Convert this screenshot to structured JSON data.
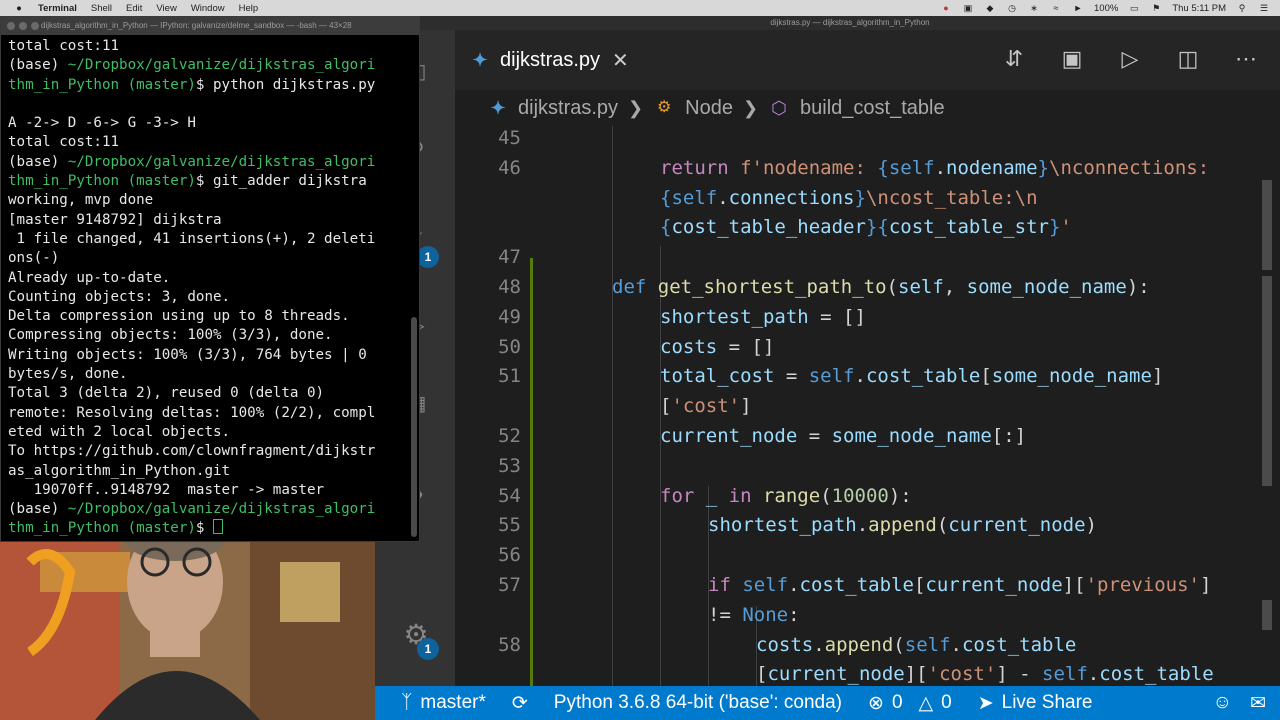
{
  "menubar": {
    "app": "Terminal",
    "items": [
      "Shell",
      "Edit",
      "View",
      "Window",
      "Help"
    ],
    "battery": "100%",
    "clock": "Thu 5:11 PM"
  },
  "terminal": {
    "title": "dijkstras_algorithm_in_Python — IPython: galvanize/delme_sandbox — -bash — 43×28",
    "lines": [
      {
        "parts": [
          {
            "t": "total cost:11",
            "c": ""
          }
        ]
      },
      {
        "parts": [
          {
            "t": "(base) ",
            "c": ""
          },
          {
            "t": "~/Dropbox/galvanize/dijkstras_algori",
            "c": "g"
          }
        ]
      },
      {
        "parts": [
          {
            "t": "thm_in_Python (master)",
            "c": "g"
          },
          {
            "t": "$ python dijkstras.py",
            "c": ""
          }
        ]
      },
      {
        "parts": [
          {
            "t": "",
            "c": ""
          }
        ]
      },
      {
        "parts": [
          {
            "t": "A -2-> D -6-> G -3-> H",
            "c": ""
          }
        ]
      },
      {
        "parts": [
          {
            "t": "total cost:11",
            "c": ""
          }
        ]
      },
      {
        "parts": [
          {
            "t": "(base) ",
            "c": ""
          },
          {
            "t": "~/Dropbox/galvanize/dijkstras_algori",
            "c": "g"
          }
        ]
      },
      {
        "parts": [
          {
            "t": "thm_in_Python (master)",
            "c": "g"
          },
          {
            "t": "$ git_adder dijkstra",
            "c": ""
          }
        ]
      },
      {
        "parts": [
          {
            "t": "working, mvp done",
            "c": ""
          }
        ]
      },
      {
        "parts": [
          {
            "t": "[master 9148792] dijkstra",
            "c": ""
          }
        ]
      },
      {
        "parts": [
          {
            "t": " 1 file changed, 41 insertions(+), 2 deleti",
            "c": ""
          }
        ]
      },
      {
        "parts": [
          {
            "t": "ons(-)",
            "c": ""
          }
        ]
      },
      {
        "parts": [
          {
            "t": "Already up-to-date.",
            "c": ""
          }
        ]
      },
      {
        "parts": [
          {
            "t": "Counting objects: 3, done.",
            "c": ""
          }
        ]
      },
      {
        "parts": [
          {
            "t": "Delta compression using up to 8 threads.",
            "c": ""
          }
        ]
      },
      {
        "parts": [
          {
            "t": "Compressing objects: 100% (3/3), done.",
            "c": ""
          }
        ]
      },
      {
        "parts": [
          {
            "t": "Writing objects: 100% (3/3), 764 bytes | 0",
            "c": ""
          }
        ]
      },
      {
        "parts": [
          {
            "t": "bytes/s, done.",
            "c": ""
          }
        ]
      },
      {
        "parts": [
          {
            "t": "Total 3 (delta 2), reused 0 (delta 0)",
            "c": ""
          }
        ]
      },
      {
        "parts": [
          {
            "t": "remote: Resolving deltas: 100% (2/2), compl",
            "c": ""
          }
        ]
      },
      {
        "parts": [
          {
            "t": "eted with 2 local objects.",
            "c": ""
          }
        ]
      },
      {
        "parts": [
          {
            "t": "To https://github.com/clownfragment/dijkstr",
            "c": ""
          }
        ]
      },
      {
        "parts": [
          {
            "t": "as_algorithm_in_Python.git",
            "c": ""
          }
        ]
      },
      {
        "parts": [
          {
            "t": "   19070ff..9148792  master -> master",
            "c": ""
          }
        ]
      },
      {
        "parts": [
          {
            "t": "(base) ",
            "c": ""
          },
          {
            "t": "~/Dropbox/galvanize/dijkstras_algori",
            "c": "g"
          }
        ]
      },
      {
        "parts": [
          {
            "t": "thm_in_Python (master)",
            "c": "g"
          },
          {
            "t": "$ ",
            "c": ""
          }
        ]
      }
    ]
  },
  "vscode": {
    "window_title": "dijkstras.py — dijkstras_algorithm_in_Python",
    "tab": {
      "label": "dijkstras.py",
      "close": "✕"
    },
    "breadcrumbs": [
      "dijkstras.py",
      "Node",
      "build_cost_table"
    ],
    "badges": {
      "source_control": "1",
      "settings": "1"
    },
    "code_lines": [
      {
        "n": "45",
        "indent": 2,
        "tokens": []
      },
      {
        "n": "46",
        "indent": 2,
        "tokens": [
          [
            "kw2",
            "return "
          ],
          [
            "str",
            "f'nodename: "
          ],
          [
            "kw",
            "{"
          ],
          [
            "self",
            "self"
          ],
          [
            "",
            "."
          ],
          [
            "var",
            "nodename"
          ],
          [
            "kw",
            "}"
          ],
          [
            "str",
            "\\nconnections:"
          ]
        ]
      },
      {
        "n": "",
        "indent": 2,
        "tokens": [
          [
            "kw",
            "{"
          ],
          [
            "self",
            "self"
          ],
          [
            "",
            "."
          ],
          [
            "var",
            "connections"
          ],
          [
            "kw",
            "}"
          ],
          [
            "str",
            "\\ncost_table:\\n"
          ]
        ]
      },
      {
        "n": "",
        "indent": 2,
        "tokens": [
          [
            "kw",
            "{"
          ],
          [
            "var",
            "cost_table_header"
          ],
          [
            "kw",
            "}{"
          ],
          [
            "var",
            "cost_table_str"
          ],
          [
            "kw",
            "}"
          ],
          [
            "str",
            "'"
          ]
        ]
      },
      {
        "n": "47",
        "indent": 0,
        "tokens": []
      },
      {
        "n": "48",
        "indent": 1,
        "tokens": [
          [
            "kw",
            "def "
          ],
          [
            "fn",
            "get_shortest_path_to"
          ],
          [
            "",
            "("
          ],
          [
            "var",
            "self"
          ],
          [
            "",
            ", "
          ],
          [
            "var",
            "some_node_name"
          ],
          [
            "",
            "):"
          ]
        ]
      },
      {
        "n": "49",
        "indent": 2,
        "tokens": [
          [
            "var",
            "shortest_path"
          ],
          [
            "",
            " = []"
          ]
        ]
      },
      {
        "n": "50",
        "indent": 2,
        "tokens": [
          [
            "var",
            "costs"
          ],
          [
            "",
            " = []"
          ]
        ]
      },
      {
        "n": "51",
        "indent": 2,
        "tokens": [
          [
            "var",
            "total_cost"
          ],
          [
            "",
            " = "
          ],
          [
            "self",
            "self"
          ],
          [
            "",
            "."
          ],
          [
            "var",
            "cost_table"
          ],
          [
            "",
            "["
          ],
          [
            "var",
            "some_node_name"
          ],
          [
            "",
            "]"
          ]
        ]
      },
      {
        "n": "",
        "indent": 2,
        "tokens": [
          [
            "",
            "["
          ],
          [
            "str",
            "'cost'"
          ],
          [
            "",
            "]"
          ]
        ]
      },
      {
        "n": "52",
        "indent": 2,
        "tokens": [
          [
            "var",
            "current_node"
          ],
          [
            "",
            " = "
          ],
          [
            "var",
            "some_node_name"
          ],
          [
            "",
            "[:]"
          ]
        ]
      },
      {
        "n": "53",
        "indent": 0,
        "tokens": []
      },
      {
        "n": "54",
        "indent": 2,
        "tokens": [
          [
            "kw2",
            "for "
          ],
          [
            "var",
            "_"
          ],
          [
            "kw2",
            " in "
          ],
          [
            "fn",
            "range"
          ],
          [
            "",
            "("
          ],
          [
            "num",
            "10000"
          ],
          [
            "",
            "):"
          ]
        ]
      },
      {
        "n": "55",
        "indent": 3,
        "tokens": [
          [
            "var",
            "shortest_path"
          ],
          [
            "",
            "."
          ],
          [
            "fn",
            "append"
          ],
          [
            "",
            "("
          ],
          [
            "var",
            "current_node"
          ],
          [
            "",
            ")"
          ]
        ]
      },
      {
        "n": "56",
        "indent": 0,
        "tokens": []
      },
      {
        "n": "57",
        "indent": 3,
        "tokens": [
          [
            "kw2",
            "if "
          ],
          [
            "self",
            "self"
          ],
          [
            "",
            "."
          ],
          [
            "var",
            "cost_table"
          ],
          [
            "",
            "["
          ],
          [
            "var",
            "current_node"
          ],
          [
            "",
            "]["
          ],
          [
            "str",
            "'previous'"
          ],
          [
            "",
            "]"
          ]
        ]
      },
      {
        "n": "",
        "indent": 3,
        "tokens": [
          [
            "",
            "!= "
          ],
          [
            "kw",
            "None"
          ],
          [
            "",
            ":"
          ]
        ]
      },
      {
        "n": "58",
        "indent": 4,
        "tokens": [
          [
            "var",
            "costs"
          ],
          [
            "",
            "."
          ],
          [
            "fn",
            "append"
          ],
          [
            "",
            "("
          ],
          [
            "self",
            "self"
          ],
          [
            "",
            "."
          ],
          [
            "var",
            "cost_table"
          ]
        ]
      },
      {
        "n": "",
        "indent": 4,
        "tokens": [
          [
            "",
            "["
          ],
          [
            "var",
            "current_node"
          ],
          [
            "",
            "]["
          ],
          [
            "str",
            "'cost'"
          ],
          [
            "",
            "] - "
          ],
          [
            "self",
            "self"
          ],
          [
            "",
            "."
          ],
          [
            "var",
            "cost_table"
          ]
        ]
      }
    ],
    "status": {
      "branch": "master*",
      "python": "Python 3.6.8 64-bit ('base': conda)",
      "errors": "0",
      "warnings": "0",
      "live_share": "Live Share"
    }
  }
}
